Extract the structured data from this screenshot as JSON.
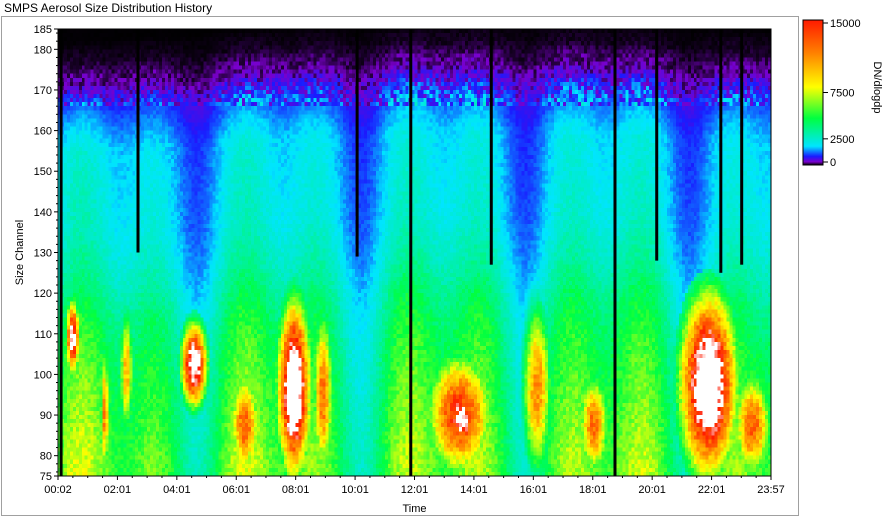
{
  "window": {
    "title": "SMPS Aerosol Size Distribution History"
  },
  "chart_data": {
    "type": "heatmap",
    "title": "",
    "xlabel": "Time",
    "ylabel": "Size Channel",
    "x_tick_labels": [
      "00:02",
      "02:01",
      "04:01",
      "06:01",
      "08:01",
      "10:01",
      "12:01",
      "14:01",
      "16:01",
      "18:01",
      "20:01",
      "22:01",
      "23:57"
    ],
    "x_range_hours": [
      0.033,
      23.95
    ],
    "ylim": [
      75,
      185
    ],
    "y_ticks": [
      75,
      80,
      90,
      100,
      110,
      120,
      130,
      140,
      150,
      160,
      170,
      180,
      185
    ],
    "colorbar": {
      "label": "DN/dlogdp",
      "range": [
        0,
        15000
      ],
      "ticks": [
        0,
        2500,
        7500,
        15000
      ],
      "tick_labels": [
        "0",
        "2500",
        "7500",
        "15000"
      ],
      "colors": [
        "#000000",
        "#7a00cc",
        "#1a1aff",
        "#00e5ff",
        "#00ff40",
        "#ffff00",
        "#ff8000",
        "#ff1a00",
        "#ffffff"
      ]
    },
    "value_profile_by_channel": {
      "channels": [
        75,
        85,
        95,
        105,
        115,
        125,
        135,
        145,
        155,
        165,
        172,
        178,
        183
      ],
      "typical_values": [
        6500,
        6000,
        5500,
        5000,
        4200,
        3200,
        2600,
        2400,
        2200,
        1300,
        300,
        60,
        5
      ]
    },
    "saturated_events": [
      {
        "start_h": 0.3,
        "end_h": 0.75,
        "ch_min": 100,
        "ch_max": 118,
        "peak": 16000
      },
      {
        "start_h": 1.45,
        "end_h": 1.75,
        "ch_min": 75,
        "ch_max": 106,
        "peak": 11000
      },
      {
        "start_h": 2.1,
        "end_h": 2.55,
        "ch_min": 85,
        "ch_max": 117,
        "peak": 9500
      },
      {
        "start_h": 4.15,
        "end_h": 5.05,
        "ch_min": 92,
        "ch_max": 113,
        "peak": 17000
      },
      {
        "start_h": 5.8,
        "end_h": 6.8,
        "ch_min": 75,
        "ch_max": 100,
        "peak": 12000
      },
      {
        "start_h": 7.4,
        "end_h": 8.5,
        "ch_min": 75,
        "ch_max": 118,
        "peak": 19000
      },
      {
        "start_h": 8.6,
        "end_h": 9.25,
        "ch_min": 75,
        "ch_max": 115,
        "peak": 11500
      },
      {
        "start_h": 12.4,
        "end_h": 14.6,
        "ch_min": 75,
        "ch_max": 105,
        "peak": 13500
      },
      {
        "start_h": 13.2,
        "end_h": 14.0,
        "ch_min": 82,
        "ch_max": 96,
        "peak": 17000
      },
      {
        "start_h": 15.6,
        "end_h": 16.6,
        "ch_min": 75,
        "ch_max": 118,
        "peak": 10500
      },
      {
        "start_h": 17.5,
        "end_h": 18.5,
        "ch_min": 75,
        "ch_max": 100,
        "peak": 11500
      },
      {
        "start_h": 20.9,
        "end_h": 22.8,
        "ch_min": 75,
        "ch_max": 120,
        "peak": 19000
      },
      {
        "start_h": 22.7,
        "end_h": 23.95,
        "ch_min": 75,
        "ch_max": 100,
        "peak": 12000
      }
    ],
    "data_gaps": [
      {
        "time_h": 0.12,
        "ch_low": 75,
        "ch_high": 185
      },
      {
        "time_h": 2.7,
        "ch_low": 130,
        "ch_high": 185
      },
      {
        "time_h": 10.05,
        "ch_low": 129,
        "ch_high": 185
      },
      {
        "time_h": 11.85,
        "ch_low": 75,
        "ch_high": 185
      },
      {
        "time_h": 14.55,
        "ch_low": 127,
        "ch_high": 185
      },
      {
        "time_h": 18.7,
        "ch_low": 75,
        "ch_high": 185
      },
      {
        "time_h": 20.1,
        "ch_low": 128,
        "ch_high": 185
      },
      {
        "time_h": 22.25,
        "ch_low": 125,
        "ch_high": 185
      },
      {
        "time_h": 22.95,
        "ch_low": 127,
        "ch_high": 185
      }
    ]
  }
}
